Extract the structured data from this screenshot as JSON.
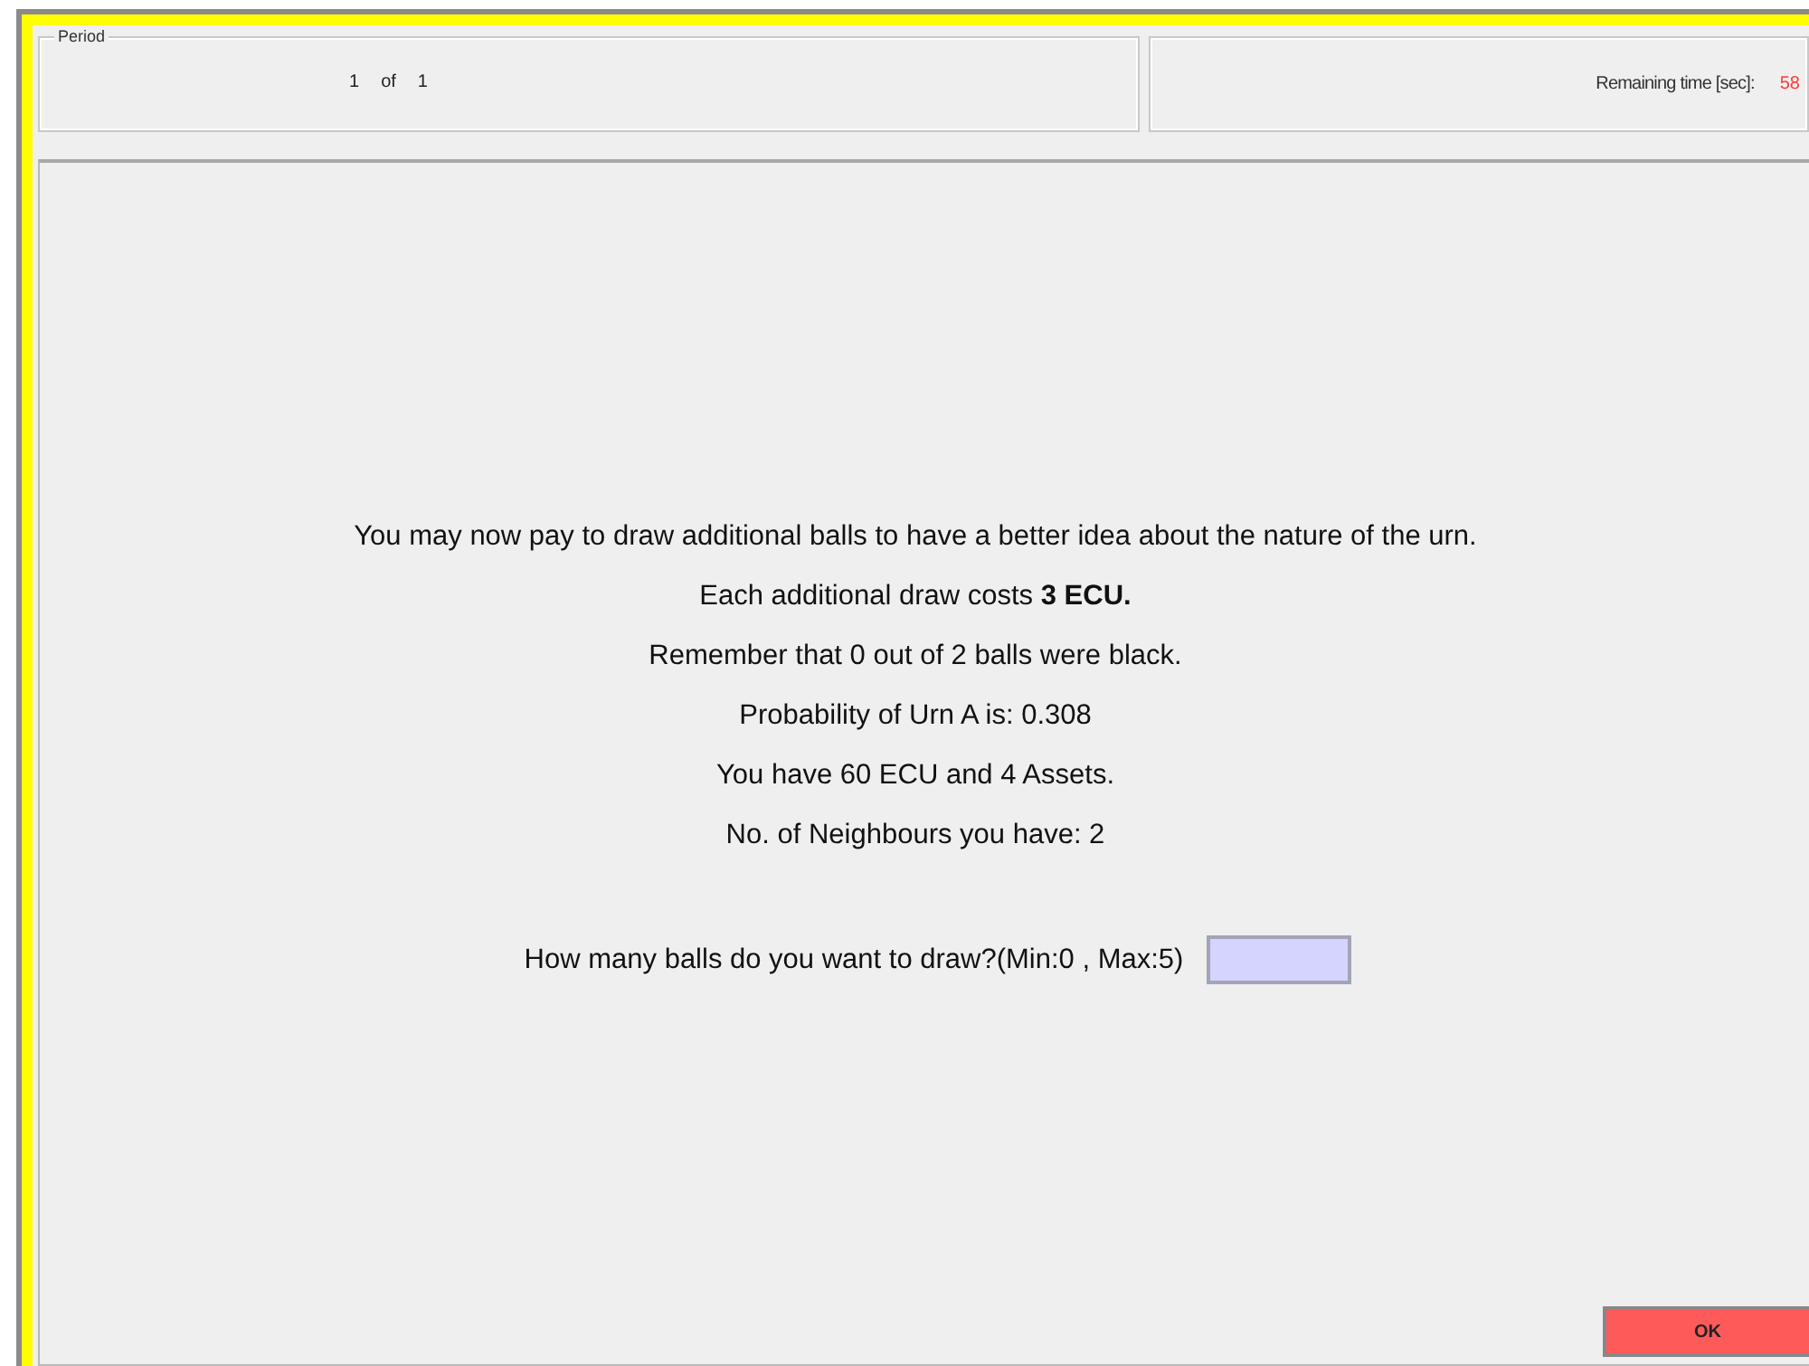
{
  "period": {
    "legend": "Period",
    "current": "1",
    "of": "of",
    "total": "1"
  },
  "timer": {
    "label": "Remaining time [sec]:",
    "value": "58"
  },
  "message": {
    "lines": [
      "You may now pay to draw additional balls to have a better idea about the nature of the urn.",
      "Each additional draw costs **3 ECU.**",
      "Remember that 0 out of 2 balls were black.",
      "Probability of Urn A is: 0.308",
      "You have 60 ECU and 4 Assets.",
      "No. of Neighbours you have: 2"
    ]
  },
  "question": {
    "label": "How many balls do you want to draw?(Min:0 , Max:5)"
  },
  "buttons": [
    {
      "label": "OK"
    }
  ]
}
